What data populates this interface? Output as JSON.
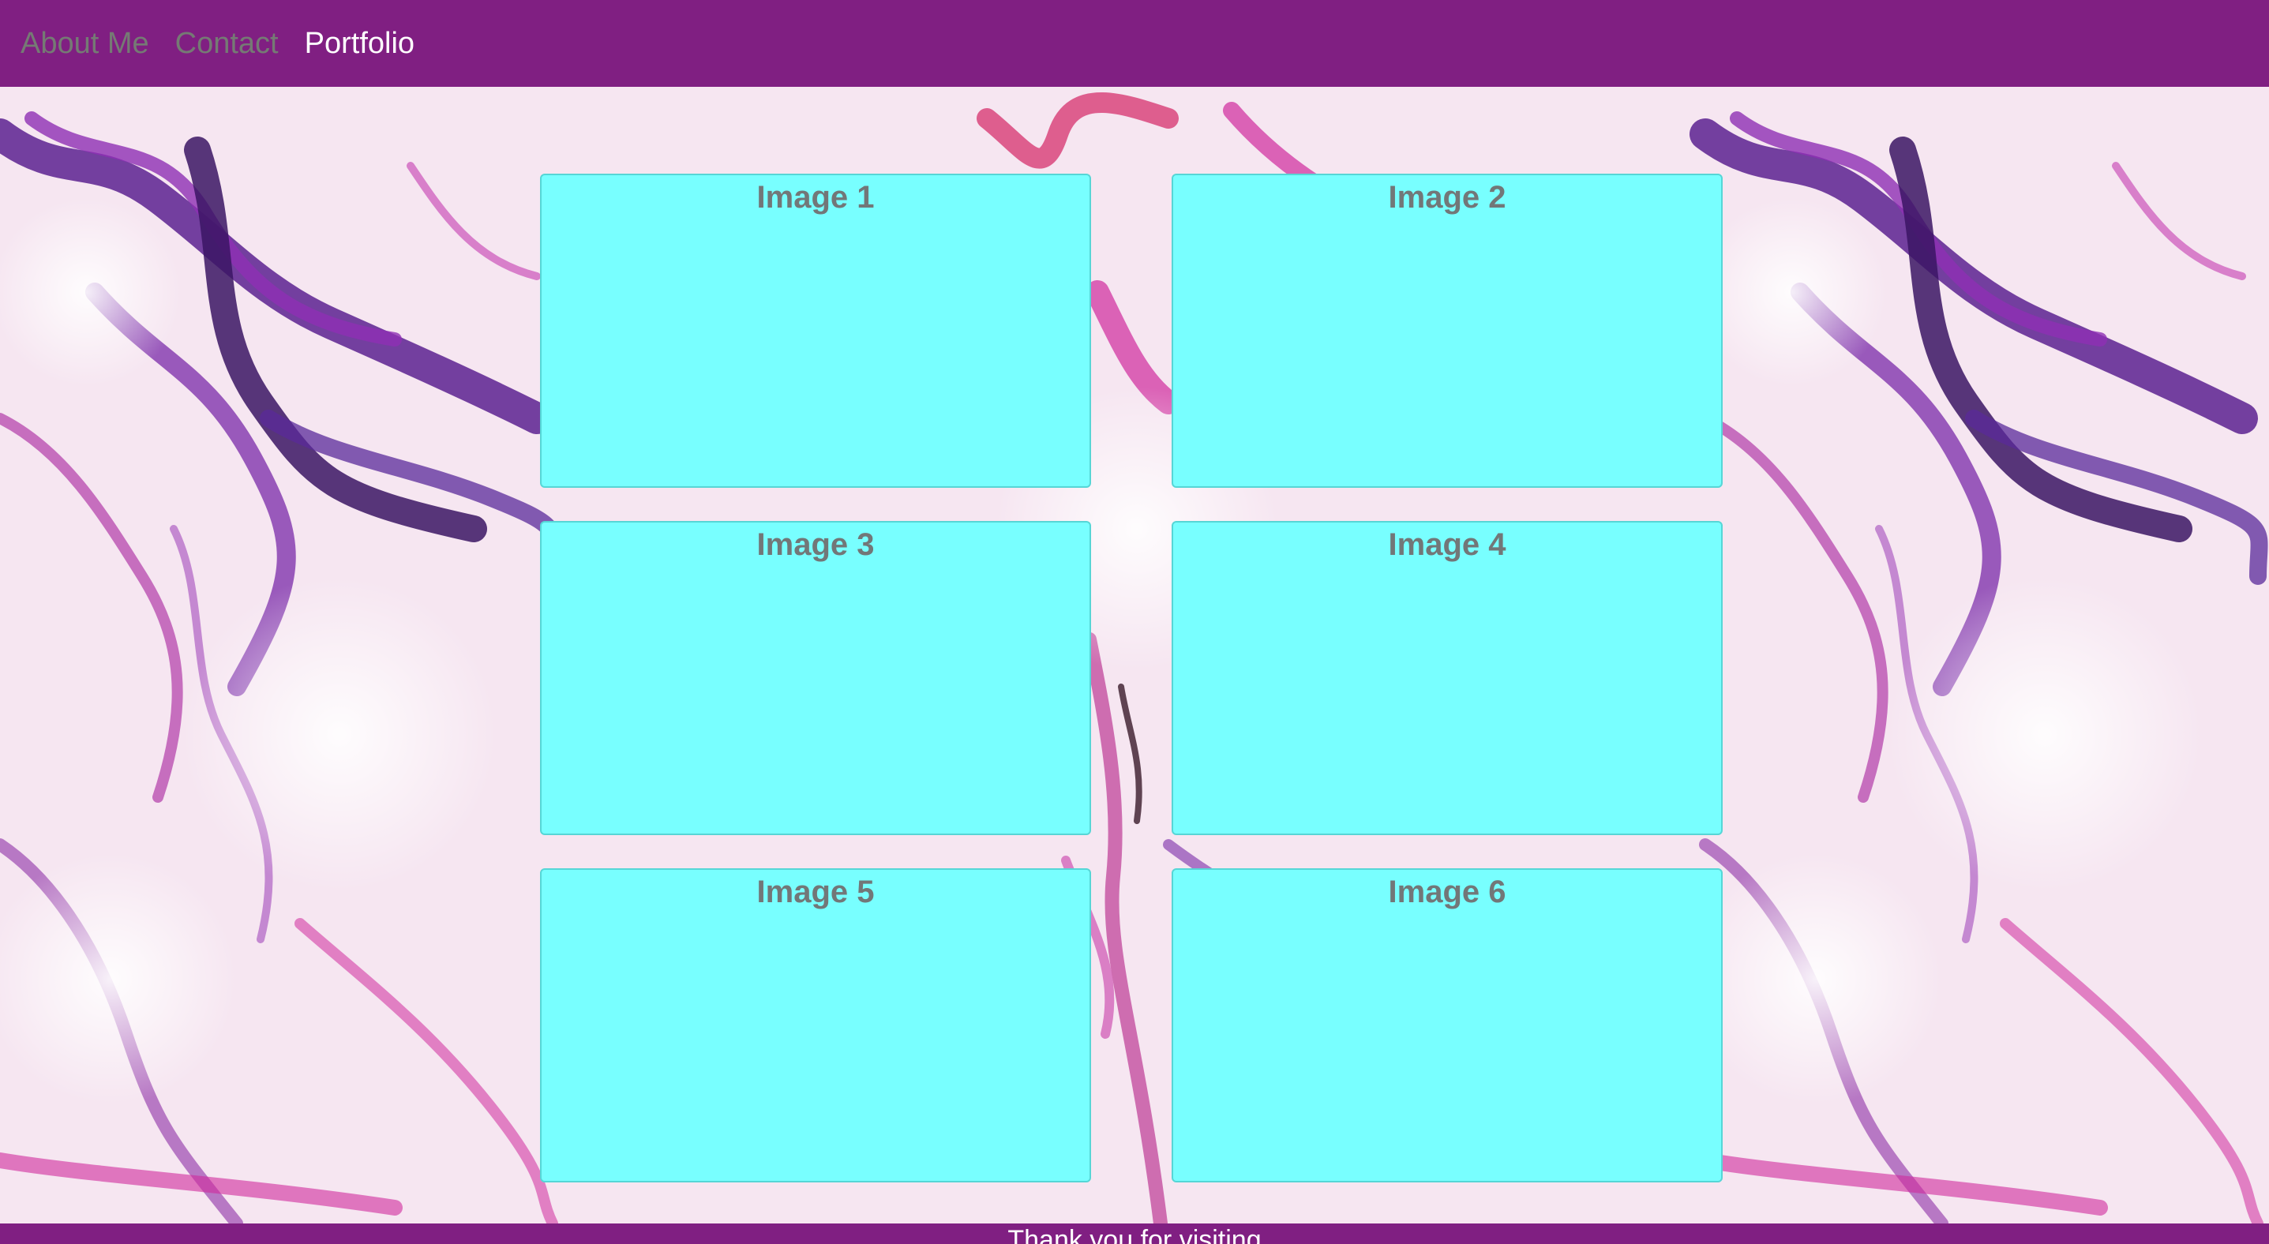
{
  "nav": {
    "items": [
      {
        "label": "About Me",
        "active": false
      },
      {
        "label": "Contact",
        "active": false
      },
      {
        "label": "Portfolio",
        "active": true
      }
    ]
  },
  "gallery": {
    "cards": [
      {
        "title": "Image 1"
      },
      {
        "title": "Image 2"
      },
      {
        "title": "Image 3"
      },
      {
        "title": "Image 4"
      },
      {
        "title": "Image 5"
      },
      {
        "title": "Image 6"
      }
    ]
  },
  "footer": {
    "text": "Thank you for visiting"
  },
  "colors": {
    "navbar_bg": "#801f82",
    "nav_inactive": "#757a74",
    "nav_active": "#ffffff",
    "card_bg": "#78ffff",
    "card_title": "#727778",
    "backdrop_base": "#f6e6f1",
    "marble_vein_purple": "#6a2a9a",
    "marble_vein_magenta": "#d02a9c"
  },
  "background": {
    "pattern": "marble-texture"
  }
}
